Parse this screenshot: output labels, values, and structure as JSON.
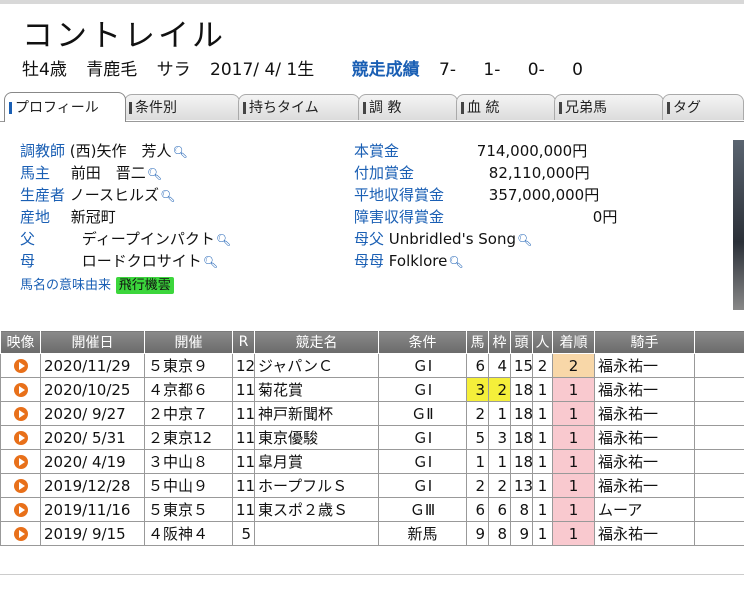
{
  "horse": {
    "name": "コントレイル",
    "sex_age": "牡4歳",
    "coat": "青鹿毛",
    "breed": "サラ",
    "birth": "2017/ 4/ 1生",
    "record_label": "競走成績",
    "record": [
      "7-",
      "1-",
      "0-",
      "0"
    ]
  },
  "tabs": [
    "プロフィール",
    "条件別",
    "持ちタイム",
    "調 教",
    "血 統",
    "兄弟馬",
    "タグ"
  ],
  "profile": {
    "trainer_label": "調教師",
    "trainer": "(西)矢作　芳人",
    "owner_label": "馬主",
    "owner": "前田　晋二",
    "breeder_label": "生産者",
    "breeder": "ノースヒルズ",
    "origin_label": "産地",
    "origin": "新冠町",
    "sire_label": "父",
    "sire": "ディープインパクト",
    "dam_label": "母",
    "dam": "ロードクロサイト",
    "name_meaning_label": "馬名の意味由来",
    "name_meaning": "飛行機雲",
    "prize_label": "本賞金",
    "prize": "714,000,000円",
    "addprize_label": "付加賞金",
    "addprize": "82,110,000円",
    "flat_label": "平地収得賞金",
    "flat": "357,000,000円",
    "jump_label": "障害収得賞金",
    "jump": "0円",
    "damsire_label": "母父",
    "damsire": "Unbridled's Song",
    "damdam_label": "母母",
    "damdam": "Folklore"
  },
  "table": {
    "headers": [
      "映像",
      "開催日",
      "開催",
      "R",
      "競走名",
      "条件",
      "馬",
      "枠",
      "頭",
      "人",
      "着順",
      "騎手"
    ],
    "rows": [
      {
        "date": "2020/11/29",
        "venue": "５東京９",
        "r": "12",
        "race": "ジャパンＣ",
        "cond": "ＧⅠ",
        "uma": "6",
        "waku": "4",
        "heads": "15",
        "pop": "2",
        "place": "2",
        "jockey": "福永祐一"
      },
      {
        "date": "2020/10/25",
        "venue": "４京都６",
        "r": "11",
        "race": "菊花賞",
        "cond": "ＧⅠ",
        "uma": "3",
        "waku": "2",
        "heads": "18",
        "pop": "1",
        "place": "1",
        "jockey": "福永祐一"
      },
      {
        "date": "2020/ 9/27",
        "venue": "２中京７",
        "r": "11",
        "race": "神戸新聞杯",
        "cond": "ＧⅡ",
        "uma": "2",
        "waku": "1",
        "heads": "18",
        "pop": "1",
        "place": "1",
        "jockey": "福永祐一"
      },
      {
        "date": "2020/ 5/31",
        "venue": "２東京12",
        "r": "11",
        "race": "東京優駿",
        "cond": "ＧⅠ",
        "uma": "5",
        "waku": "3",
        "heads": "18",
        "pop": "1",
        "place": "1",
        "jockey": "福永祐一"
      },
      {
        "date": "2020/ 4/19",
        "venue": "３中山８",
        "r": "11",
        "race": "皐月賞",
        "cond": "ＧⅠ",
        "uma": "1",
        "waku": "1",
        "heads": "18",
        "pop": "1",
        "place": "1",
        "jockey": "福永祐一"
      },
      {
        "date": "2019/12/28",
        "venue": "５中山９",
        "r": "11",
        "race": "ホープフルＳ",
        "cond": "ＧⅠ",
        "uma": "2",
        "waku": "2",
        "heads": "13",
        "pop": "1",
        "place": "1",
        "jockey": "福永祐一"
      },
      {
        "date": "2019/11/16",
        "venue": "５東京５",
        "r": "11",
        "race": "東スポ２歳Ｓ",
        "cond": "ＧⅢ",
        "uma": "6",
        "waku": "6",
        "heads": "8",
        "pop": "1",
        "place": "1",
        "jockey": "ムーア"
      },
      {
        "date": "2019/ 9/15",
        "venue": "４阪神４",
        "r": "5",
        "race": "",
        "cond": "新馬",
        "uma": "9",
        "waku": "8",
        "heads": "9",
        "pop": "1",
        "place": "1",
        "jockey": "福永祐一"
      }
    ]
  },
  "colors": {
    "link": "#1a5fb4",
    "header": "#777777",
    "win": "#f9c9cf",
    "second": "#f8d7a8",
    "highlight_yellow": "#f5ef3a",
    "highlight_green": "#3cd63c"
  }
}
